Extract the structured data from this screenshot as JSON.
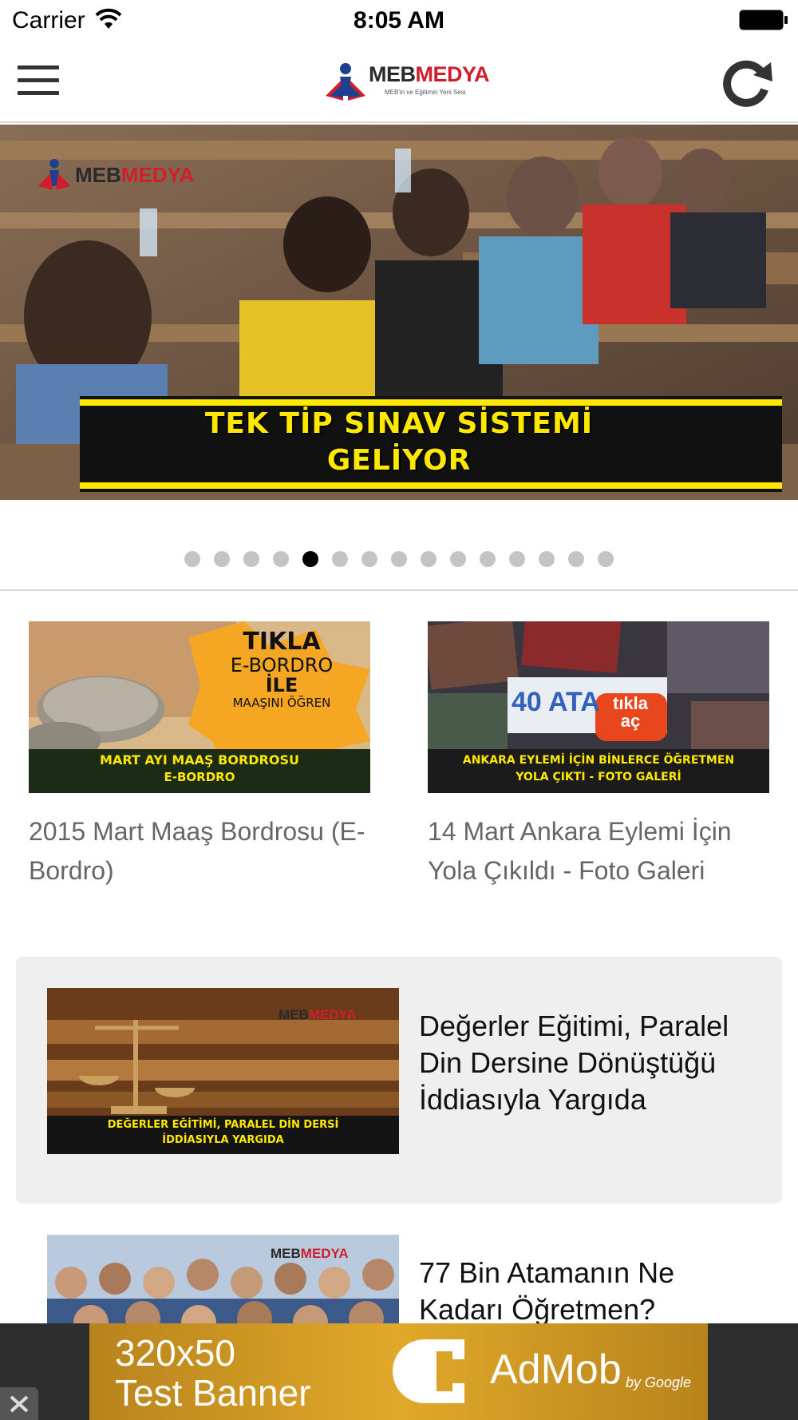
{
  "status_bar": {
    "carrier": "Carrier",
    "time": "8:05 AM"
  },
  "nav": {
    "logo_part1": "MEB",
    "logo_part2": "MEDYA",
    "logo_tagline": "MEB'in ve Eğitimin Yeni Sesi"
  },
  "hero": {
    "brand_part1": "MEB",
    "brand_part2": "MEDYA",
    "title_line1": "TEK TİP SINAV SİSTEMİ",
    "title_line2": "GELİYOR",
    "page_count": 15,
    "active_page": 5
  },
  "grid": [
    {
      "caption": "2015 Mart Maaş Bordrosu (E-Bordro)",
      "img_line1": "TIKLA",
      "img_line2": "E-BORDRO",
      "img_line3": "İLE",
      "img_line4": "MAAŞINI ÖĞREN",
      "img_band1": "MART AYI MAAŞ BORDROSU",
      "img_band2": "E-BORDRO"
    },
    {
      "caption": "14 Mart Ankara Eylemi İçin Yola Çıkıldı - Foto Galeri",
      "img_sign": "40 ATA",
      "img_tag1": "tıkla",
      "img_tag2": "aç",
      "img_band1": "ANKARA EYLEMİ İÇİN BİNLERCE ÖĞRETMEN",
      "img_band2": "YOLA ÇIKTI - FOTO GALERİ"
    }
  ],
  "list": [
    {
      "title": "Değerler Eğitimi, Paralel Din Dersine Dönüştüğü İddiasıyla Yargıda",
      "img_band1": "DEĞERLER EĞİTİMİ, PARALEL DİN DERSİ",
      "img_band2": "İDDİASIYLA YARGIDA",
      "img_brand1": "MEB",
      "img_brand2": "MEDYA"
    },
    {
      "title": "77 Bin Atamanın Ne Kadarı Öğretmen?",
      "img_brand1": "MEB",
      "img_brand2": "MEDYA"
    }
  ],
  "ad": {
    "line1": "320x50",
    "line2": "Test Banner",
    "brand": "AdMob",
    "sub": "by Google"
  },
  "colors": {
    "brand_red": "#d11e2c",
    "banner_yellow": "#ffe800",
    "dot_active": "#000000",
    "dot_inactive": "#c4c4c4",
    "card_bg": "#efefef"
  }
}
